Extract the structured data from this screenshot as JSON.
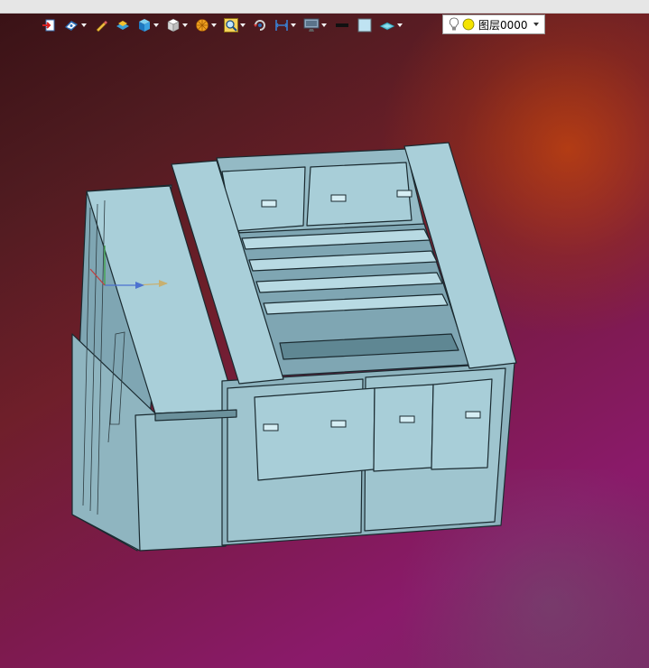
{
  "toolbar": {
    "buttons": [
      {
        "icon": "exit-icon",
        "dropdown": false
      },
      {
        "icon": "render-mode-icon",
        "dropdown": true
      },
      {
        "icon": "pen-icon",
        "dropdown": false
      },
      {
        "icon": "layer-box-icon",
        "dropdown": false
      },
      {
        "icon": "solid-cube-icon",
        "dropdown": true
      },
      {
        "icon": "view-cube-icon",
        "dropdown": true
      },
      {
        "icon": "section-icon",
        "dropdown": true
      },
      {
        "icon": "zoom-icon",
        "dropdown": true
      },
      {
        "icon": "rotate-icon",
        "dropdown": false
      },
      {
        "icon": "measure-icon",
        "dropdown": true
      },
      {
        "icon": "display-icon",
        "dropdown": true
      },
      {
        "icon": "line-color-icon",
        "dropdown": false
      },
      {
        "icon": "fill-color-icon",
        "dropdown": false
      },
      {
        "icon": "plane-icon",
        "dropdown": true
      }
    ],
    "layer": {
      "name": "图层0000"
    }
  },
  "colors": {
    "background_top_left": "#3a1216",
    "background_top_right": "#a8340e",
    "background_bottom_left": "#8a1a6a",
    "model_face": "#a9cfd9",
    "model_shade": "#8fb5c0",
    "edge": "#1a2a30"
  }
}
